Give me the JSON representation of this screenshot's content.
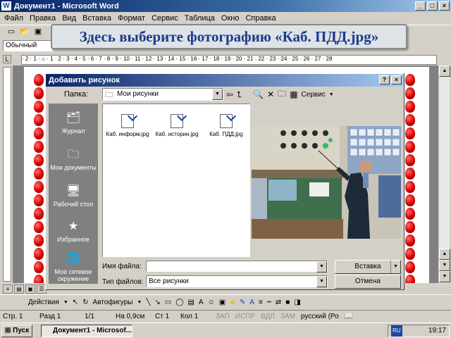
{
  "window": {
    "title": "Документ1 - Microsoft Word"
  },
  "menu": [
    "Файл",
    "Правка",
    "Вид",
    "Вставка",
    "Формат",
    "Сервис",
    "Таблица",
    "Окно",
    "Справка"
  ],
  "toolbar": {
    "style_value": "Обычный"
  },
  "callout": {
    "text": "Здесь выберите фотографию «Каб. ПДД.jpg»"
  },
  "ruler": {
    "text": "· 2 · 1 · ⌂ · 1 · 2 · 3 · 4 · 5 · 6 · 7 · 8 · 9 · 10 · 11 · 12 · 13 · 14 · 15 · 16 · 17 · 18 · 19 · 20 · 21 · 22 · 23 · 24 · 25 · 26 · 27 · 28"
  },
  "dialog": {
    "title": "Добавить рисунок",
    "look_in_label": "Папка:",
    "look_in_value": "Мои рисунки",
    "tools_label": "Сервис",
    "places": [
      {
        "label": "Журнал",
        "icon": "history-icon"
      },
      {
        "label": "Мои документы",
        "icon": "folder-icon"
      },
      {
        "label": "Рабочий стол",
        "icon": "desktop-icon"
      },
      {
        "label": "Избранное",
        "icon": "favorites-icon"
      },
      {
        "label": "Мое сетевое окружение",
        "icon": "network-icon"
      }
    ],
    "files": [
      {
        "name": "Каб. информ.jpg"
      },
      {
        "name": "Каб. историн.jpg"
      },
      {
        "name": "Каб. ПДД.jpg"
      }
    ],
    "filename_label": "Имя файла:",
    "filename_value": "",
    "filetype_label": "Тип файлов:",
    "filetype_value": "Все рисунки",
    "insert_button": "Вставка",
    "cancel_button": "Отмена"
  },
  "drawbar": {
    "actions_label": "Действия",
    "autoshapes_label": "Автофигуры"
  },
  "status": {
    "page": "Стр. 1",
    "section": "Разд 1",
    "pages": "1/1",
    "at": "На 0,9см",
    "line": "Ст 1",
    "col": "Кол 1",
    "rec": "ЗАП",
    "trk": "ИСПР",
    "ext": "ВДЛ",
    "ovr": "ЗАМ",
    "lang": "русский (Ро"
  },
  "taskbar": {
    "start_label": "Пуск",
    "task_label": "Документ1 - Microsof...",
    "lang_indicator": "RU",
    "clock": "19:17"
  },
  "colors": {
    "title_bar": "#0a246a",
    "callout_text": "#1e3a8c",
    "apple": "#d40000"
  }
}
